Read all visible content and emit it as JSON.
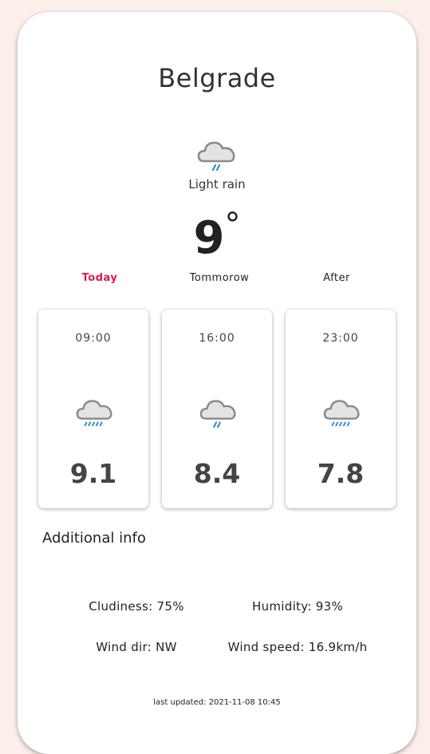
{
  "city": "Belgrade",
  "current": {
    "icon": "light-rain-cloud-icon",
    "condition": "Light rain",
    "temperature": "9",
    "degree_symbol": "°"
  },
  "tabs": [
    {
      "label": "Today",
      "active": true
    },
    {
      "label": "Tommorow",
      "active": false
    },
    {
      "label": "After",
      "active": false
    }
  ],
  "hourly": [
    {
      "time": "09:00",
      "icon": "moderate-rain-cloud-icon",
      "temp": "9.1"
    },
    {
      "time": "16:00",
      "icon": "light-rain-cloud-icon",
      "temp": "8.4"
    },
    {
      "time": "23:00",
      "icon": "moderate-rain-cloud-icon",
      "temp": "7.8"
    }
  ],
  "additional": {
    "title": "Additional info",
    "cloudiness": "Cludiness: 75%",
    "humidity": "Humidity: 93%",
    "wind_dir": "Wind dir: NW",
    "wind_speed": "Wind speed: 16.9km/h"
  },
  "last_updated": "last updated: 2021-11-08 10:45",
  "colors": {
    "accent": "#d81b4a",
    "background": "#fcefe9",
    "rain": "#2a8fd8",
    "cloud_fill": "#e3e3e3",
    "cloud_stroke": "#8a8a8a"
  }
}
